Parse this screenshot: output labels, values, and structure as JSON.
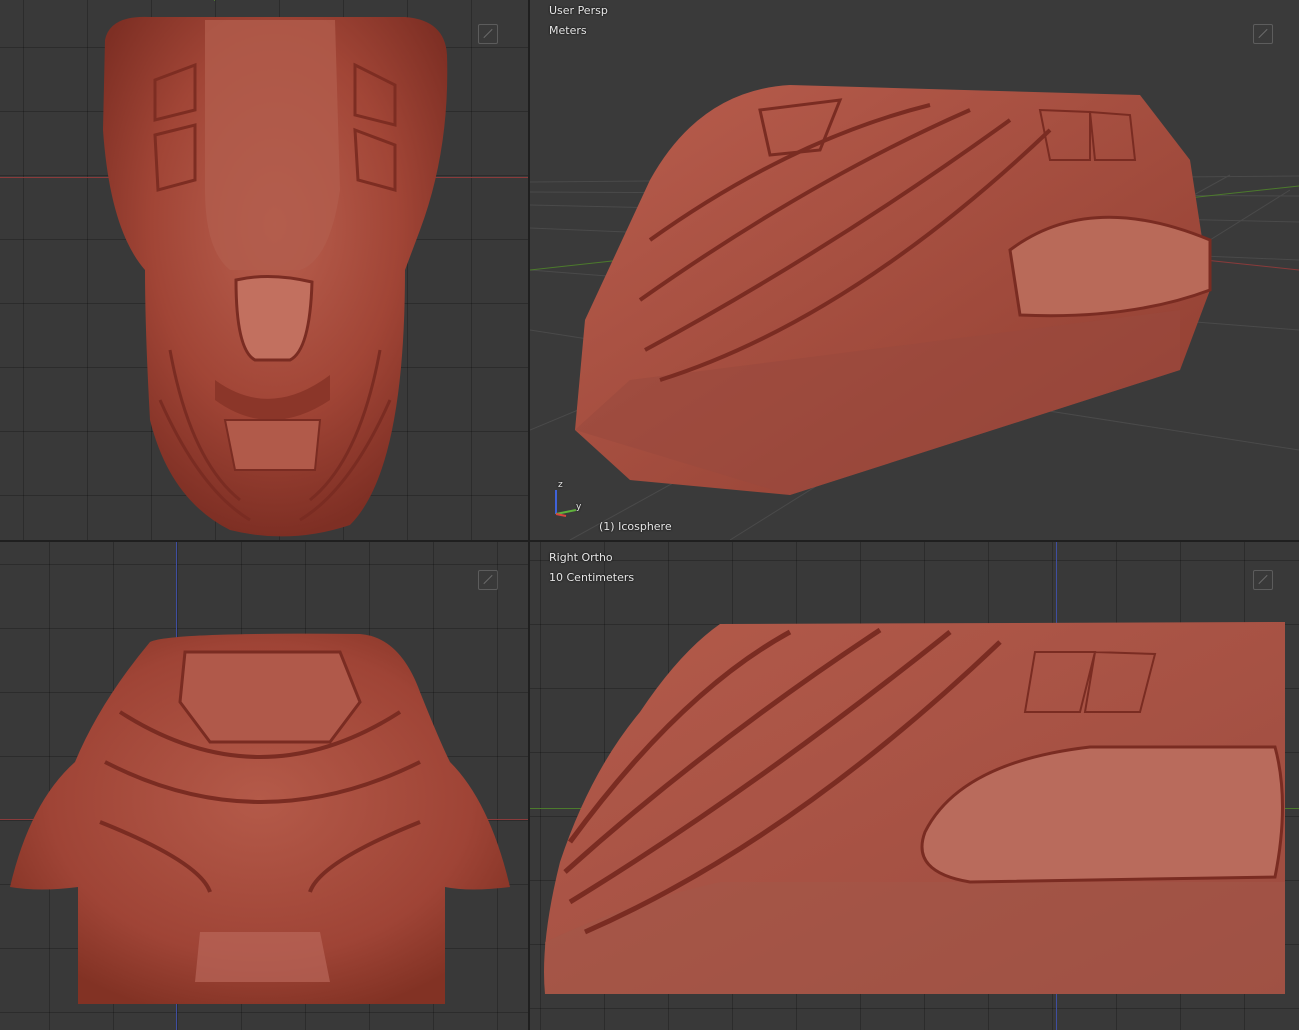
{
  "app": "Blender",
  "layout": "quad-view",
  "viewports": {
    "top_left": {
      "name": "",
      "scale": "",
      "object": ""
    },
    "top_right": {
      "name": "User Persp",
      "scale": "Meters",
      "object": "(1) Icosphere"
    },
    "bottom_left": {
      "name": "",
      "scale": "",
      "object": ""
    },
    "bottom_right": {
      "name": "Right Ortho",
      "scale": "10 Centimeters",
      "object": ""
    }
  },
  "gizmo": {
    "z": "z",
    "y": "y"
  },
  "colors": {
    "viewport_bg": "#393939",
    "mesh": "#a5493c",
    "x_axis": "#8a3b3b",
    "y_axis": "#4c7a2c",
    "z_axis": "#3f4ea0"
  },
  "icons": [
    "view-split-widget-icon"
  ]
}
